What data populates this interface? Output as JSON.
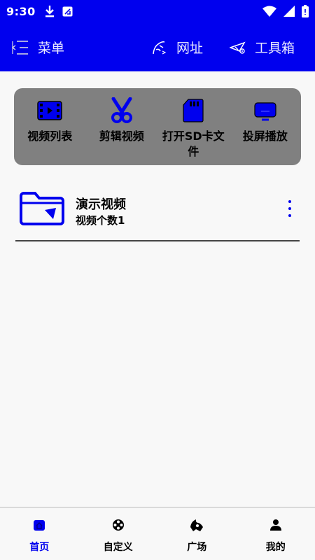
{
  "status_bar": {
    "time": "9:30"
  },
  "app_bar": {
    "menu_label": "菜单",
    "url_label": "网址",
    "tools_label": "工具箱"
  },
  "quick_actions": [
    {
      "label": "视频列表",
      "icon": "video-list-icon"
    },
    {
      "label": "剪辑视频",
      "icon": "scissors-icon"
    },
    {
      "label": "打开SD卡文件",
      "icon": "sd-card-icon"
    },
    {
      "label": "投屏播放",
      "icon": "cast-screen-icon"
    }
  ],
  "folder": {
    "title": "演示视频",
    "count_text": "视频个数1",
    "icon": "folder-icon"
  },
  "bottom_nav": [
    {
      "label": "首页",
      "icon": "home-icon",
      "active": true
    },
    {
      "label": "自定义",
      "icon": "film-reel-icon",
      "active": false
    },
    {
      "label": "广场",
      "icon": "plaza-icon",
      "active": false
    },
    {
      "label": "我的",
      "icon": "person-icon",
      "active": false
    }
  ],
  "colors": {
    "brand": "#0000ee",
    "panel": "#808080",
    "background": "#f8f8f8"
  }
}
